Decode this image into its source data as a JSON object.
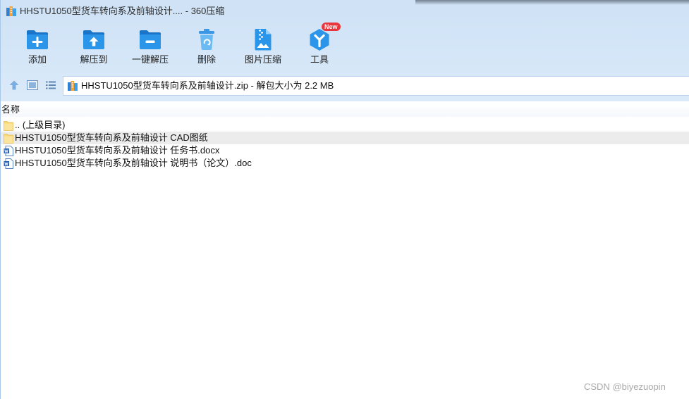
{
  "window": {
    "title": "HHSTU1050型货车转向系及前轴设计.... - 360压缩",
    "app_icon": "zip-archive-icon"
  },
  "toolbar": {
    "buttons": [
      {
        "label": "添加",
        "icon": "add-folder-icon"
      },
      {
        "label": "解压到",
        "icon": "extract-to-icon"
      },
      {
        "label": "一键解压",
        "icon": "one-click-extract-icon"
      },
      {
        "label": "删除",
        "icon": "recycle-bin-icon"
      },
      {
        "label": "图片压缩",
        "icon": "image-compress-icon"
      },
      {
        "label": "工具",
        "icon": "tools-icon",
        "badge": "New"
      }
    ]
  },
  "navbar": {
    "buttons": [
      {
        "icon": "up-arrow-icon"
      },
      {
        "icon": "thumbnail-view-icon"
      },
      {
        "icon": "list-view-icon"
      }
    ],
    "path_icon": "zip-archive-icon",
    "path": "HHSTU1050型货车转向系及前轴设计.zip - 解包大小为 2.2 MB"
  },
  "file_list": {
    "columns": [
      "名称"
    ],
    "rows": [
      {
        "name": ".. (上级目录)",
        "icon": "folder-icon",
        "highlighted": false
      },
      {
        "name": "HHSTU1050型货车转向系及前轴设计 CAD图纸",
        "icon": "folder-icon",
        "highlighted": true
      },
      {
        "name": "HHSTU1050型货车转向系及前轴设计 任务书.docx",
        "icon": "word-document-icon",
        "highlighted": false
      },
      {
        "name": "HHSTU1050型货车转向系及前轴设计 说明书（论文）.doc",
        "icon": "word-document-icon",
        "highlighted": false
      }
    ]
  },
  "watermark": "CSDN @biyezuopin",
  "colors": {
    "chrome_background": "#d4e6f7",
    "accent": "#2b95ea",
    "badge": "#e8383d",
    "folder": "#f8d978",
    "row_highlight": "#ececec"
  }
}
